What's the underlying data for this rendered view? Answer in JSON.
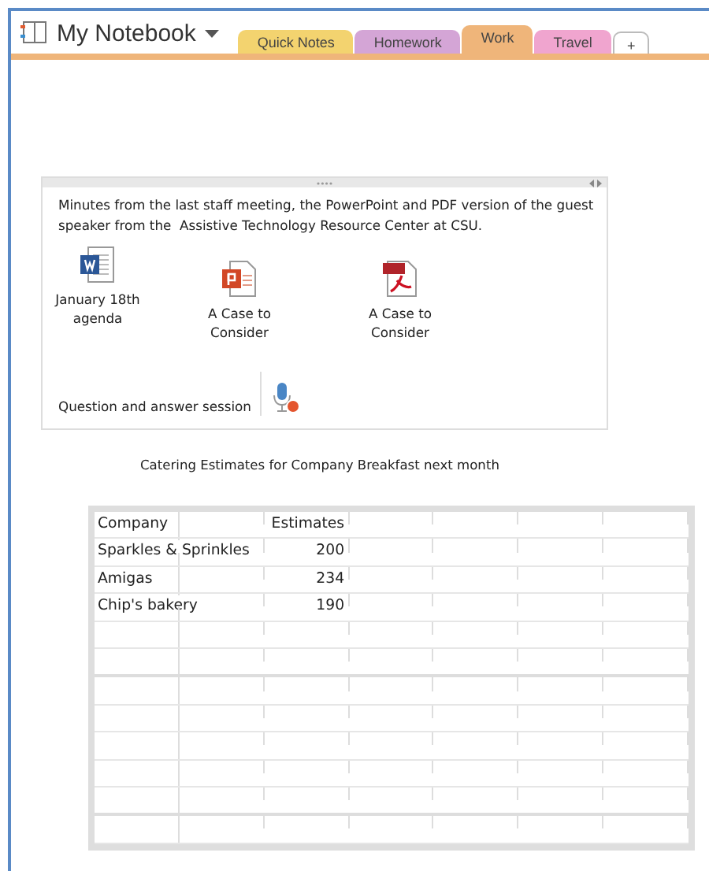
{
  "notebook": {
    "title": "My Notebook"
  },
  "tabs": [
    {
      "label": "Quick Notes",
      "color": "#f3d36f",
      "selected": false
    },
    {
      "label": "Homework",
      "color": "#d4a5d6",
      "selected": false
    },
    {
      "label": "Work",
      "color": "#efb57a",
      "selected": true
    },
    {
      "label": "Travel",
      "color": "#f0a5cf",
      "selected": false
    },
    {
      "label": "+",
      "color": "#ffffff",
      "selected": false
    }
  ],
  "note": {
    "text": "Minutes from the last staff meeting, the PowerPoint and PDF version of the guest speaker from the  Assistive Technology Resource Center at CSU.",
    "attachments": [
      {
        "kind": "word",
        "label": "January 18th agenda"
      },
      {
        "kind": "powerpoint",
        "label": "A Case to Consider"
      },
      {
        "kind": "pdf",
        "label": "A Case to Consider"
      }
    ],
    "audio": {
      "label": "Question and answer session"
    }
  },
  "caption": "Catering Estimates for Company Breakfast next month",
  "table": {
    "rows": [
      [
        "Company",
        "Estimates"
      ],
      [
        "Sparkles & Sprinkles",
        "200"
      ],
      [
        "Amigas",
        "234"
      ],
      [
        "Chip's bakery",
        "190"
      ],
      [],
      [],
      [],
      [],
      [],
      [],
      [],
      []
    ]
  }
}
